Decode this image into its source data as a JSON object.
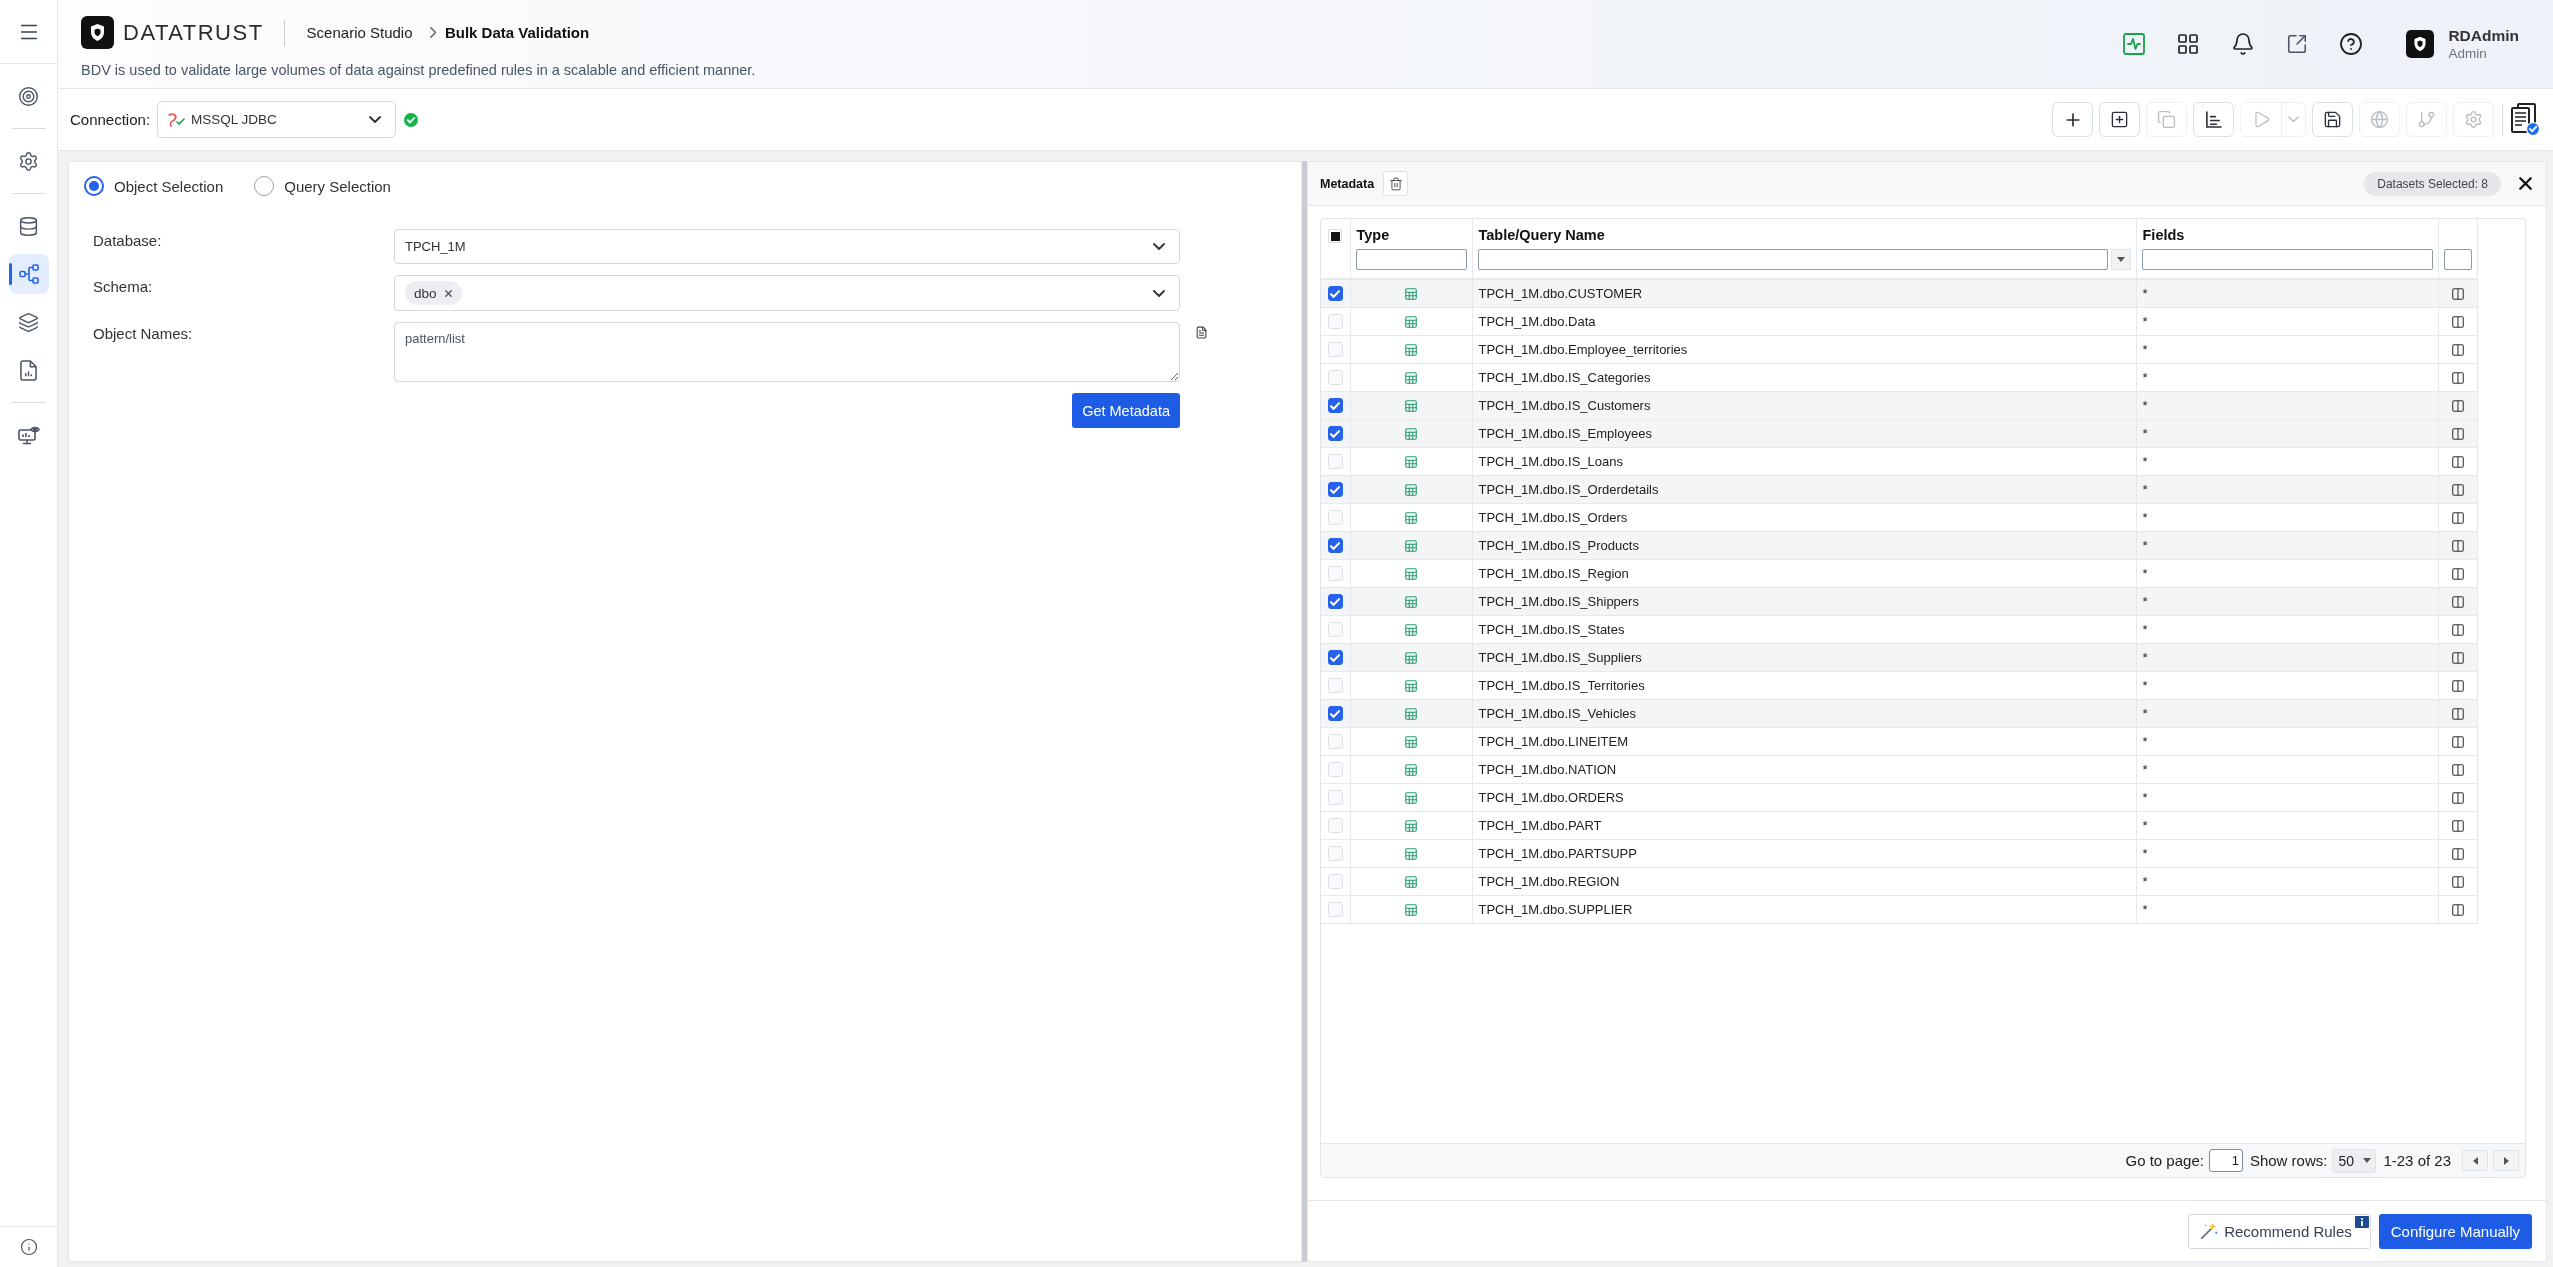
{
  "sidebar": {
    "groups": [
      {
        "items": [
          {
            "selected": false
          }
        ]
      },
      {
        "items": [
          {
            "selected": false
          }
        ]
      },
      {
        "items": [
          {
            "selected": false
          },
          {
            "selected": true
          },
          {
            "selected": false
          },
          {
            "selected": false
          }
        ]
      },
      {
        "items": [
          {
            "selected": false
          }
        ]
      }
    ]
  },
  "header": {
    "logo": "DATATRUST",
    "breadcrumb": [
      "Scenario Studio",
      "Bulk Data Validation"
    ],
    "description": "BDV is used to validate large volumes of data against predefined rules in a scalable and efficient manner.",
    "user": {
      "name": "RDAdmin",
      "role": "Admin"
    }
  },
  "toolbar": {
    "connection": {
      "label": "Connection:",
      "value": "MSSQL JDBC",
      "connected": true
    },
    "buttons": [
      {
        "disabled": false
      },
      {
        "disabled": false
      },
      {
        "disabled": true
      },
      {
        "disabled": false
      },
      {
        "disabled": true
      },
      {
        "disabled": false
      },
      {
        "disabled": true
      },
      {
        "disabled": true
      },
      {
        "disabled": true
      }
    ]
  },
  "selection": {
    "options": [
      {
        "label": "Object Selection",
        "selected": true
      },
      {
        "label": "Query Selection",
        "selected": false
      }
    ]
  },
  "form": {
    "database": {
      "label": "Database:",
      "value": "TPCH_1M"
    },
    "schema": {
      "label": "Schema:",
      "chips": [
        "dbo"
      ]
    },
    "object_names": {
      "label": "Object Names:",
      "placeholder": "pattern/list"
    },
    "submit": "Get Metadata"
  },
  "metadata": {
    "title": "Metadata",
    "badge": "Datasets Selected: 8",
    "table": {
      "select_all": {
        "indeterminate": true
      },
      "columns": [
        "Type",
        "Table/Query Name",
        "Fields"
      ],
      "rows": [
        {
          "checked": true,
          "name": "TPCH_1M.dbo.CUSTOMER",
          "fields": "*"
        },
        {
          "checked": false,
          "name": "TPCH_1M.dbo.Data",
          "fields": "*"
        },
        {
          "checked": false,
          "name": "TPCH_1M.dbo.Employee_territories",
          "fields": "*"
        },
        {
          "checked": false,
          "name": "TPCH_1M.dbo.IS_Categories",
          "fields": "*"
        },
        {
          "checked": true,
          "name": "TPCH_1M.dbo.IS_Customers",
          "fields": "*"
        },
        {
          "checked": true,
          "name": "TPCH_1M.dbo.IS_Employees",
          "fields": "*"
        },
        {
          "checked": false,
          "name": "TPCH_1M.dbo.IS_Loans",
          "fields": "*"
        },
        {
          "checked": true,
          "name": "TPCH_1M.dbo.IS_Orderdetails",
          "fields": "*"
        },
        {
          "checked": false,
          "name": "TPCH_1M.dbo.IS_Orders",
          "fields": "*"
        },
        {
          "checked": true,
          "name": "TPCH_1M.dbo.IS_Products",
          "fields": "*"
        },
        {
          "checked": false,
          "name": "TPCH_1M.dbo.IS_Region",
          "fields": "*"
        },
        {
          "checked": true,
          "name": "TPCH_1M.dbo.IS_Shippers",
          "fields": "*"
        },
        {
          "checked": false,
          "name": "TPCH_1M.dbo.IS_States",
          "fields": "*"
        },
        {
          "checked": true,
          "name": "TPCH_1M.dbo.IS_Suppliers",
          "fields": "*"
        },
        {
          "checked": false,
          "name": "TPCH_1M.dbo.IS_Territories",
          "fields": "*"
        },
        {
          "checked": true,
          "name": "TPCH_1M.dbo.IS_Vehicles",
          "fields": "*"
        },
        {
          "checked": false,
          "name": "TPCH_1M.dbo.LINEITEM",
          "fields": "*"
        },
        {
          "checked": false,
          "name": "TPCH_1M.dbo.NATION",
          "fields": "*"
        },
        {
          "checked": false,
          "name": "TPCH_1M.dbo.ORDERS",
          "fields": "*"
        },
        {
          "checked": false,
          "name": "TPCH_1M.dbo.PART",
          "fields": "*"
        },
        {
          "checked": false,
          "name": "TPCH_1M.dbo.PARTSUPP",
          "fields": "*"
        },
        {
          "checked": false,
          "name": "TPCH_1M.dbo.REGION",
          "fields": "*"
        },
        {
          "checked": false,
          "name": "TPCH_1M.dbo.SUPPLIER",
          "fields": "*"
        }
      ]
    },
    "pagination": {
      "goto_label": "Go to page:",
      "page": "1",
      "rows_label": "Show rows:",
      "rows": "50",
      "range": "1-23 of 23"
    }
  },
  "footer": {
    "buttons": [
      {
        "label": "Recommend Rules",
        "kind": "secondary"
      },
      {
        "label": "Configure Manually",
        "kind": "primary"
      }
    ]
  }
}
